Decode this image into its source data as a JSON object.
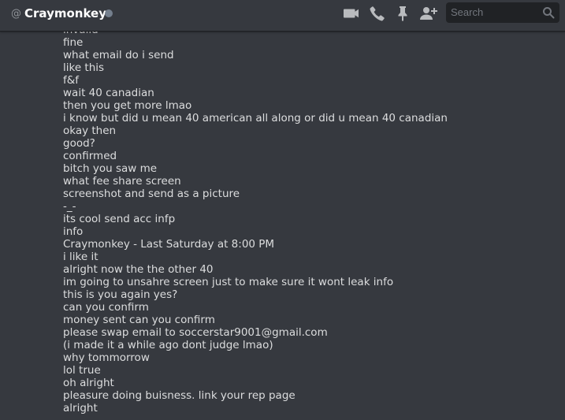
{
  "header": {
    "at_symbol": "@",
    "channel_name": "Craymonkey",
    "status": "offline",
    "status_color": "#747f8d",
    "icons": [
      "video-call-icon",
      "voice-call-icon",
      "pinned-messages-icon",
      "add-friend-icon"
    ],
    "search_placeholder": "Search"
  },
  "colors": {
    "background": "#36393f",
    "search_bg": "#202225",
    "text": "#dcddde",
    "icon": "#b9bbbe"
  },
  "messages": [
    "invalid",
    "fine",
    "what email do i send",
    "like this",
    "f&f",
    "wait 40 canadian",
    "then you get more lmao",
    "i know but did u mean 40 american all along or did u mean 40 canadian",
    "okay then",
    "good?",
    "confirmed",
    "bitch you saw me",
    "what fee share screen",
    "screenshot and send as a picture",
    "-_-",
    "its cool send acc infp",
    "info",
    "Craymonkey - Last Saturday at 8:00 PM",
    "i like it",
    "alright now the the other 40",
    "im going to unsahre screen just to make sure it wont leak info",
    "this is you again yes?",
    "can you confirm",
    "money sent can you confirm",
    "please swap email to soccerstar9001@gmail.com",
    "(i made it a while ago dont judge lmao)",
    "why tommorrow",
    "lol true",
    "oh alright",
    "pleasure doing buisness. link your rep page",
    "alright"
  ]
}
